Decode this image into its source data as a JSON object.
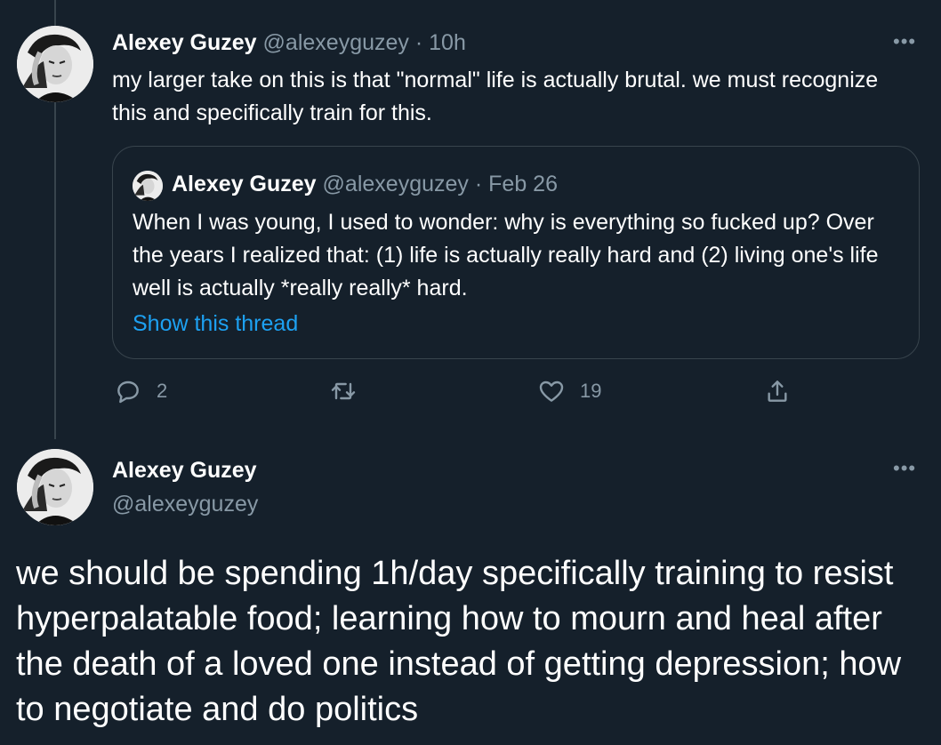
{
  "tweet1": {
    "name": "Alexey Guzey",
    "handle": "@alexeyguzey",
    "separator": "·",
    "time": "10h",
    "text": "my larger take on this is that \"normal\" life is actually brutal. we must recognize this and specifically train for this.",
    "more": "•••",
    "quoted": {
      "name": "Alexey Guzey",
      "handle": "@alexeyguzey",
      "separator": "·",
      "time": "Feb 26",
      "text": "When I was young, I used to wonder: why is everything so fucked up? Over the years I realized that: (1) life is actually really hard and (2) living one's life well is actually *really really* hard.",
      "link": "Show this thread"
    },
    "actions": {
      "reply_count": "2",
      "retweet_count": "",
      "like_count": "19"
    }
  },
  "tweet2": {
    "name": "Alexey Guzey",
    "handle": "@alexeyguzey",
    "more": "•••",
    "text": "we should be spending 1h/day specifically training to resist hyperpalatable food; learning how to mourn and heal after the death of a loved one instead of getting depression; how to negotiate and do politics"
  },
  "colors": {
    "background": "#15202b",
    "muted": "#8899a6",
    "link": "#1da1f2",
    "border": "#38444d"
  },
  "icons": [
    "reply-icon",
    "retweet-icon",
    "like-icon",
    "share-icon",
    "more-icon"
  ]
}
